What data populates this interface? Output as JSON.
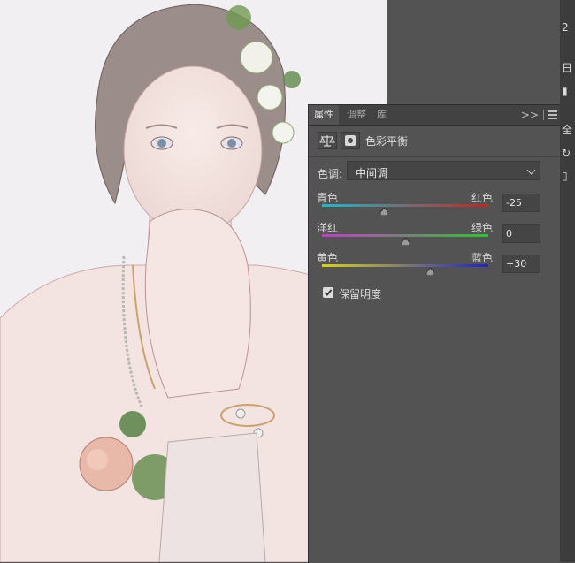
{
  "panel": {
    "tabs": [
      {
        "label": "属性",
        "active": true
      },
      {
        "label": "调整",
        "active": false
      },
      {
        "label": "库",
        "active": false
      }
    ],
    "collapse_glyph": ">>",
    "title": "色彩平衡",
    "tone": {
      "label": "色调:",
      "value": "中间调"
    },
    "sliders": [
      {
        "left_label": "青色",
        "right_label": "红色",
        "value": "-25",
        "fraction": 0.375,
        "gradient": [
          "#1fb8c4",
          "#c42626"
        ]
      },
      {
        "left_label": "洋红",
        "right_label": "绿色",
        "value": "0",
        "fraction": 0.5,
        "gradient": [
          "#c23dc8",
          "#2ec42e"
        ]
      },
      {
        "left_label": "黄色",
        "right_label": "蓝色",
        "value": "+30",
        "fraction": 0.65,
        "gradient": [
          "#d8d21c",
          "#2222c8"
        ]
      }
    ],
    "preserve_luminosity": {
      "label": "保留明度",
      "checked": true
    }
  },
  "right_strip": {
    "glyphs": [
      "2",
      "日",
      "▮",
      "全",
      "↻",
      "▯"
    ]
  },
  "canvas": {
    "photo_desc_icon": "portrait-sketch-image"
  },
  "colors": {
    "panel_bg": "#535353",
    "tab_bg": "#424242"
  }
}
